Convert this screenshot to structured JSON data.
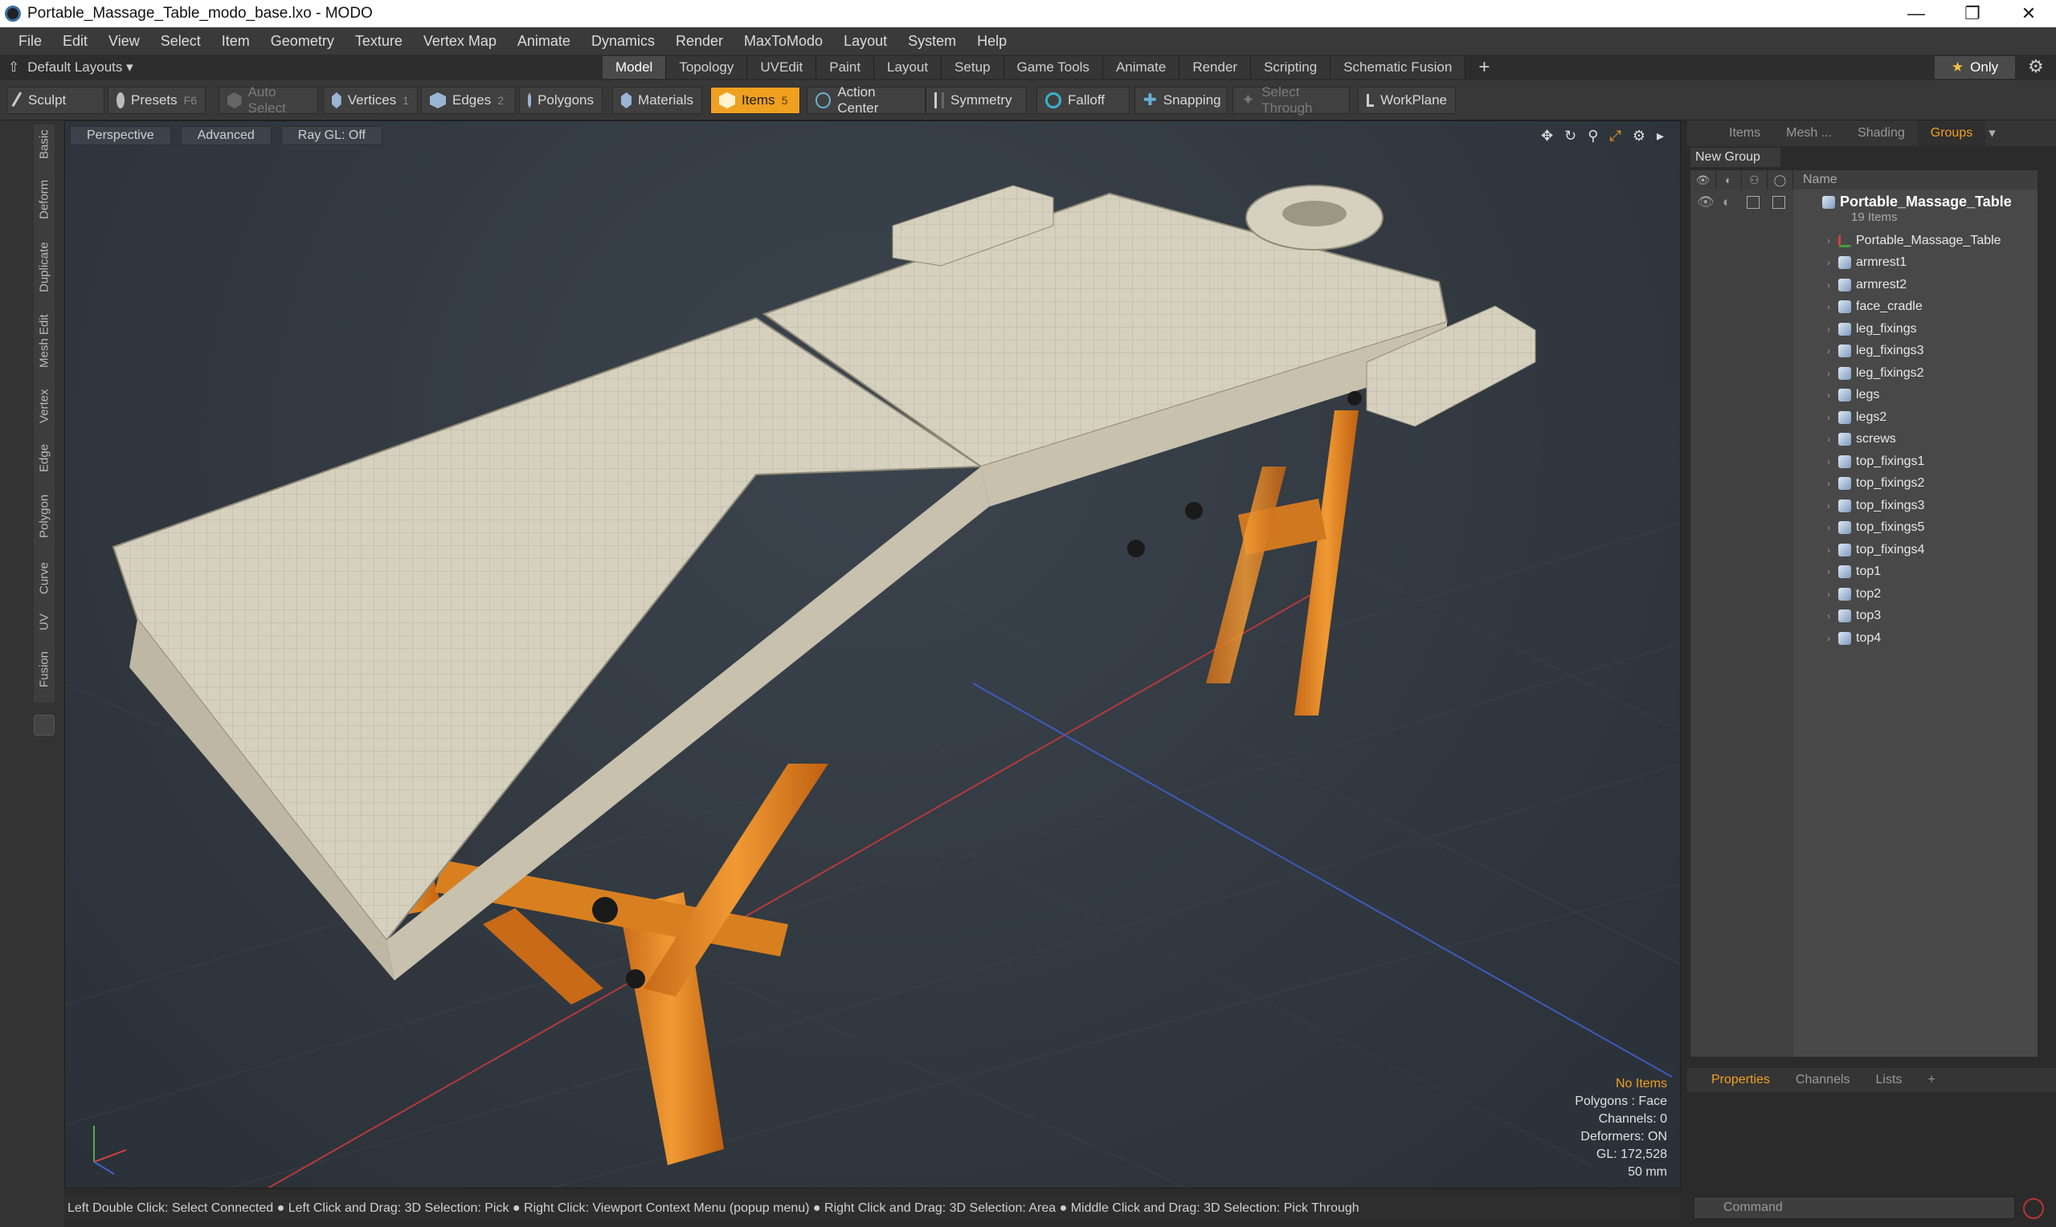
{
  "window": {
    "title": "Portable_Massage_Table_modo_base.lxo - MODO"
  },
  "menu": [
    "File",
    "Edit",
    "View",
    "Select",
    "Item",
    "Geometry",
    "Texture",
    "Vertex Map",
    "Animate",
    "Dynamics",
    "Render",
    "MaxToModo",
    "Layout",
    "System",
    "Help"
  ],
  "layout": {
    "dropdown": "Default Layouts ▾",
    "only_label": "Only"
  },
  "tabs": [
    "Model",
    "Topology",
    "UVEdit",
    "Paint",
    "Layout",
    "Setup",
    "Game Tools",
    "Animate",
    "Render",
    "Scripting",
    "Schematic Fusion"
  ],
  "toolbar": {
    "sculpt": "Sculpt",
    "presets": "Presets",
    "presets_key": "F6",
    "auto_select": "Auto Select",
    "vertices": "Vertices",
    "vertices_n": "1",
    "edges": "Edges",
    "edges_n": "2",
    "polygons": "Polygons",
    "materials": "Materials",
    "items": "Items",
    "items_n": "5",
    "action_center": "Action Center",
    "symmetry": "Symmetry",
    "falloff": "Falloff",
    "snapping": "Snapping",
    "select_through": "Select Through",
    "workplane": "WorkPlane"
  },
  "side_tabs": [
    "Basic",
    "Deform",
    "Duplicate",
    "Mesh Edit",
    "Vertex",
    "Edge",
    "Polygon",
    "Curve",
    "UV",
    "Fusion"
  ],
  "viewport": {
    "perspective": "Perspective",
    "advanced": "Advanced",
    "raygl": "Ray GL: Off",
    "hud": {
      "items": "No Items",
      "polygons": "Polygons : Face",
      "channels": "Channels: 0",
      "deformers": "Deformers: ON",
      "gl": "GL: 172,528",
      "lens": "50 mm"
    }
  },
  "status": "Left Double Click: Select Connected ● Left Click and Drag: 3D Selection: Pick ● Right Click: Viewport Context Menu (popup menu) ● Right Click and Drag: 3D Selection: Area ● Middle Click and Drag: 3D Selection: Pick Through",
  "right_panel": {
    "tabs": [
      "Items",
      "Mesh ...",
      "Shading",
      "Groups"
    ],
    "new_group": "New Group",
    "name_header": "Name",
    "root": "Portable_Massage_Table",
    "root_sub": "19 Items",
    "items": [
      "Portable_Massage_Table",
      "armrest1",
      "armrest2",
      "face_cradle",
      "leg_fixings",
      "leg_fixings3",
      "leg_fixings2",
      "legs",
      "legs2",
      "screws",
      "top_fixings1",
      "top_fixings2",
      "top_fixings3",
      "top_fixings5",
      "top_fixings4",
      "top1",
      "top2",
      "top3",
      "top4"
    ],
    "bottom_tabs": [
      "Properties",
      "Channels",
      "Lists"
    ],
    "command_placeholder": "Command"
  },
  "colors": {
    "accent": "#f0a020",
    "wood": "#e08a28",
    "cushion": "#d9d4c2"
  }
}
